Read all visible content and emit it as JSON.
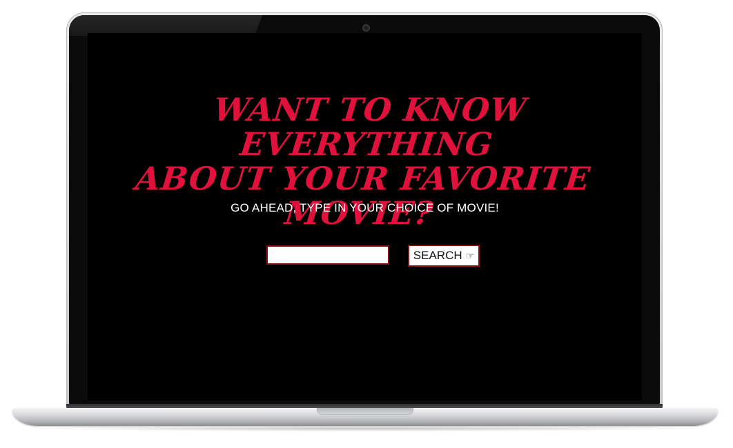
{
  "hero": {
    "headline_line1": "WANT TO KNOW EVERYTHING",
    "headline_line2": "ABOUT YOUR FAVORITE MOVIE?",
    "subtitle": "GO AHEAD, TYPE IN YOUR CHOICE OF MOVIE!"
  },
  "search": {
    "input_value": "",
    "button_label": "SEARCH",
    "button_icon": "pointing-hand-icon"
  },
  "colors": {
    "accent": "#e0123c",
    "background": "#000000",
    "border": "#8c1010"
  }
}
